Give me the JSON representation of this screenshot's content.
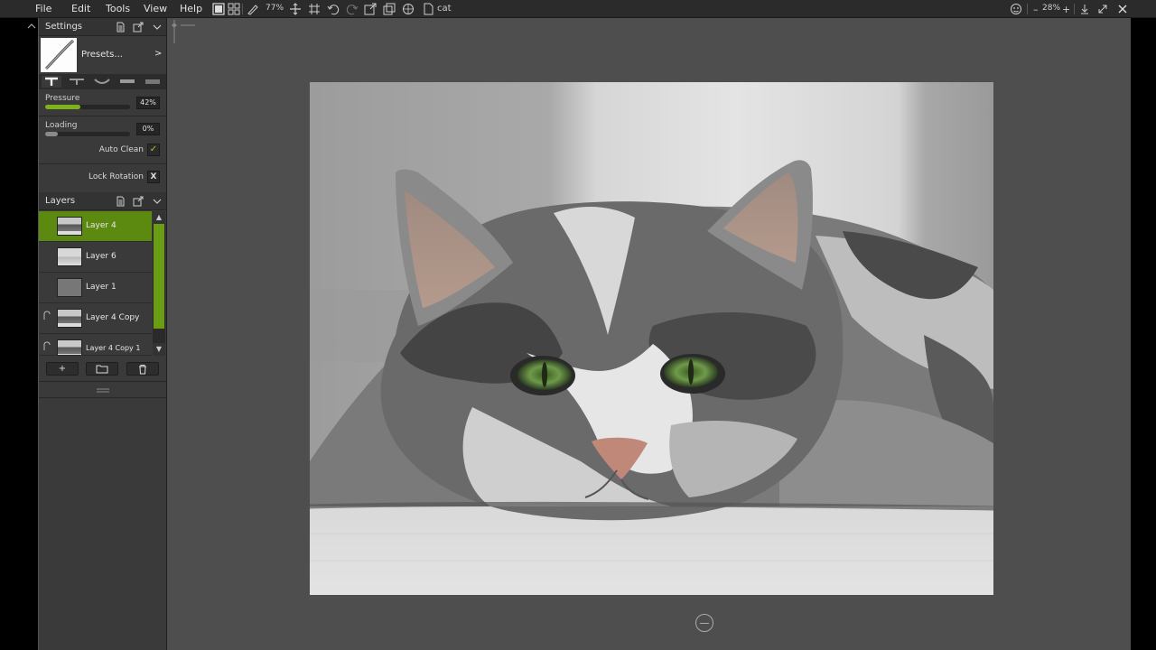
{
  "menu": {
    "file": "File",
    "edit": "Edit",
    "tools": "Tools",
    "view": "View",
    "help": "Help"
  },
  "toolbar": {
    "brush_size": "77%",
    "document_name": "cat",
    "zoom_level": "28%",
    "zoom_out": "–",
    "zoom_in": "+"
  },
  "settings": {
    "title": "Settings",
    "presets_label": "Presets...",
    "presets_arrow": ">",
    "pressure_label": "Pressure",
    "pressure_value": "42%",
    "pressure_fraction": 0.42,
    "loading_label": "Loading",
    "loading_value": "0%",
    "loading_fraction": 0.0,
    "auto_clean_label": "Auto Clean",
    "auto_clean_check": "✓",
    "lock_rotation_label": "Lock Rotation",
    "lock_rotation_x": "X"
  },
  "layers": {
    "title": "Layers",
    "items": [
      {
        "name": "Layer 4",
        "selected": true
      },
      {
        "name": "Layer 6",
        "selected": false
      },
      {
        "name": "Layer 1",
        "selected": false
      },
      {
        "name": "Layer 4 Copy",
        "selected": false
      },
      {
        "name": "Layer 4 Copy 1",
        "selected": false
      }
    ],
    "add_label": "+",
    "scroll_up": "▲",
    "scroll_down": "▼"
  },
  "colors": {
    "accent": "#6a9d15",
    "workspace": "#4e4e4e",
    "panel": "#3a3a3a"
  }
}
